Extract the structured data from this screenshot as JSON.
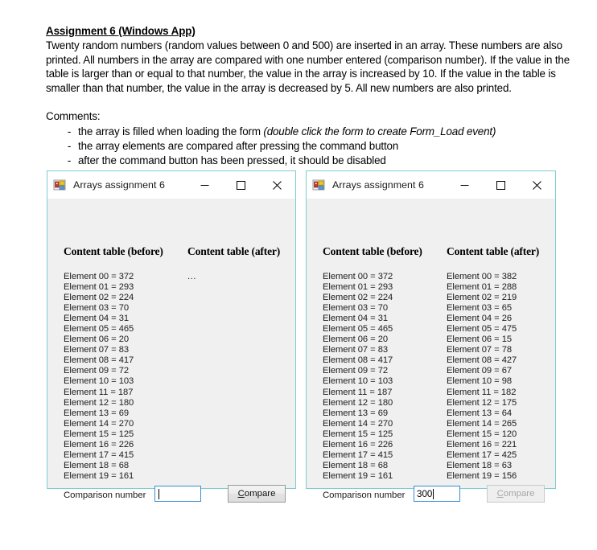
{
  "document": {
    "clipped_top_line": "",
    "title": "Assignment 6 (Windows App)",
    "paragraph": "Twenty random numbers (random values between 0 and 500) are inserted in an array. These numbers are also printed. All numbers in the array are compared with one number entered (comparison number). If the value in the table is larger than or equal to that number, the value in the array is increased by 10. If the value in the table is smaller than that number, the value in the array is decreased by 5. All new numbers are also printed.",
    "comments_label": "Comments:",
    "bullet_marker": "-",
    "comments": [
      {
        "text": "the array is filled when loading the form ",
        "emphasis": "(double click the form to create Form_Load event)"
      },
      {
        "text": "the array elements are compared after pressing the command button",
        "emphasis": ""
      },
      {
        "text": "after the command button has been pressed, it should be disabled",
        "emphasis": ""
      }
    ]
  },
  "window_chrome": {
    "title": "Arrays assignment 6",
    "minimize_label": "Minimize",
    "maximize_label": "Maximize",
    "close_label": "Close",
    "border_color": "#7ccdce",
    "body_color": "#f0f0f0",
    "titlebar_color": "#ffffff"
  },
  "labels": {
    "header_before": "Content table (before)",
    "header_after": "Content table (after)",
    "comparison_number": "Comparison number",
    "compare_accel": "C",
    "compare_rest": "ompare",
    "placeholder_dots": "..."
  },
  "window_1": {
    "before": [
      "Element 00 = 372",
      "Element 01 = 293",
      "Element 02 = 224",
      "Element 03 = 70",
      "Element 04 = 31",
      "Element 05 = 465",
      "Element 06 = 20",
      "Element 07 = 83",
      "Element 08 = 417",
      "Element 09 = 72",
      "Element 10 = 103",
      "Element 11 = 187",
      "Element 12 = 180",
      "Element 13 = 69",
      "Element 14 = 270",
      "Element 15 = 125",
      "Element 16 = 226",
      "Element 17 = 415",
      "Element 18 = 68",
      "Element 19 = 161"
    ],
    "after": [],
    "after_placeholder": "...",
    "comparison_value": "",
    "input_focused": true,
    "compare_enabled": true
  },
  "window_2": {
    "before": [
      "Element 00 = 372",
      "Element 01 = 293",
      "Element 02 = 224",
      "Element 03 = 70",
      "Element 04 = 31",
      "Element 05 = 465",
      "Element 06 = 20",
      "Element 07 = 83",
      "Element 08 = 417",
      "Element 09 = 72",
      "Element 10 = 103",
      "Element 11 = 187",
      "Element 12 = 180",
      "Element 13 = 69",
      "Element 14 = 270",
      "Element 15 = 125",
      "Element 16 = 226",
      "Element 17 = 415",
      "Element 18 = 68",
      "Element 19 = 161"
    ],
    "after": [
      "Element 00 = 382",
      "Element 01 = 288",
      "Element 02 = 219",
      "Element 03 = 65",
      "Element 04 = 26",
      "Element 05 = 475",
      "Element 06 = 15",
      "Element 07 = 78",
      "Element 08 = 427",
      "Element 09 = 67",
      "Element 10 = 98",
      "Element 11 = 182",
      "Element 12 = 175",
      "Element 13 = 64",
      "Element 14 = 265",
      "Element 15 = 120",
      "Element 16 = 221",
      "Element 17 = 425",
      "Element 18 = 63",
      "Element 19 = 156"
    ],
    "after_placeholder": "",
    "comparison_value": "300",
    "input_focused": true,
    "compare_enabled": false
  }
}
